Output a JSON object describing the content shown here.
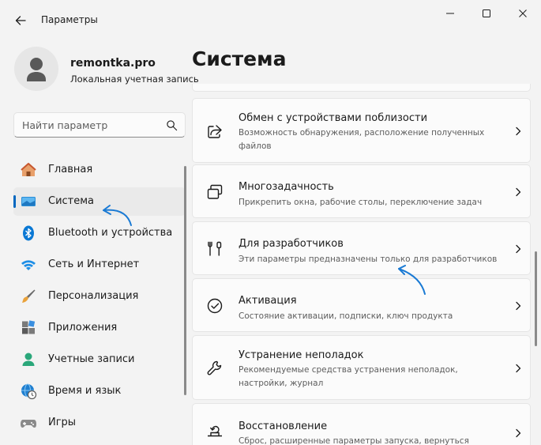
{
  "window": {
    "title": "Параметры"
  },
  "user": {
    "name": "remontka.pro",
    "account_type": "Локальная учетная запись"
  },
  "search": {
    "placeholder": "Найти параметр"
  },
  "page": {
    "title": "Система"
  },
  "sidebar": {
    "items": [
      {
        "label": "Главная",
        "icon": "home-icon"
      },
      {
        "label": "Система",
        "icon": "monitor-icon",
        "selected": true
      },
      {
        "label": "Bluetooth и устройства",
        "icon": "bluetooth-icon"
      },
      {
        "label": "Сеть и Интернет",
        "icon": "wifi-icon"
      },
      {
        "label": "Персонализация",
        "icon": "paintbrush-icon"
      },
      {
        "label": "Приложения",
        "icon": "apps-icon"
      },
      {
        "label": "Учетные записи",
        "icon": "person-icon"
      },
      {
        "label": "Время и язык",
        "icon": "globe-clock-icon"
      },
      {
        "label": "Игры",
        "icon": "gamepad-icon"
      }
    ]
  },
  "settings": [
    {
      "title": "Обмен с устройствами поблизости",
      "desc": "Возможность обнаружения, расположение полученных файлов",
      "icon": "share-icon"
    },
    {
      "title": "Многозадачность",
      "desc": "Прикрепить окна, рабочие столы, переключение задач",
      "icon": "multitask-icon"
    },
    {
      "title": "Для разработчиков",
      "desc": "Эти параметры предназначены только для разработчиков",
      "icon": "developer-tools-icon"
    },
    {
      "title": "Активация",
      "desc": "Состояние активации, подписки, ключ продукта",
      "icon": "check-circle-icon"
    },
    {
      "title": "Устранение неполадок",
      "desc": "Рекомендуемые средства устранения неполадок, настройки, журнал",
      "icon": "wrench-icon"
    },
    {
      "title": "Восстановление",
      "desc": "Сброс, расширенные параметры запуска, вернуться",
      "icon": "recovery-icon"
    }
  ],
  "colors": {
    "accent": "#0067c0",
    "annotation": "#1a7ad4",
    "background": "#f3f3f3",
    "card": "#fbfbfb"
  }
}
